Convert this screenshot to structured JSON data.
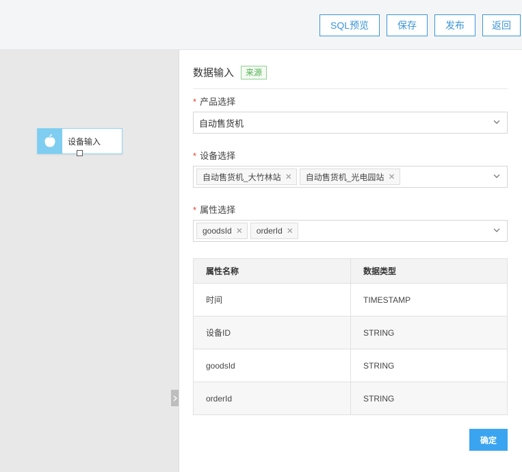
{
  "toolbar": {
    "sql_preview": "SQL预览",
    "save": "保存",
    "publish": "发布",
    "back": "返回"
  },
  "canvas": {
    "node": {
      "label": "设备输入",
      "icon": "apple-icon"
    },
    "collapse_icon": "chevron-right-icon"
  },
  "panel": {
    "title": "数据输入",
    "tag": "来源",
    "product": {
      "label": "产品选择",
      "required_mark": "*",
      "value": "自动售货机"
    },
    "device": {
      "label": "设备选择",
      "required_mark": "*",
      "chips": [
        "自动售货机_大竹林站",
        "自动售货机_光电园站"
      ]
    },
    "attribute": {
      "label": "属性选择",
      "required_mark": "*",
      "chips": [
        "goodsId",
        "orderId"
      ]
    },
    "table": {
      "headers": [
        "属性名称",
        "数据类型"
      ],
      "rows": [
        [
          "时间",
          "TIMESTAMP"
        ],
        [
          "设备ID",
          "STRING"
        ],
        [
          "goodsId",
          "STRING"
        ],
        [
          "orderId",
          "STRING"
        ]
      ]
    },
    "confirm": "确定"
  },
  "colors": {
    "accent": "#3a95d8",
    "primary_button": "#3ba4f0",
    "tag_green": "#52b152",
    "required_red": "#e0402f",
    "node_icon_bg": "#7fcdf0"
  }
}
